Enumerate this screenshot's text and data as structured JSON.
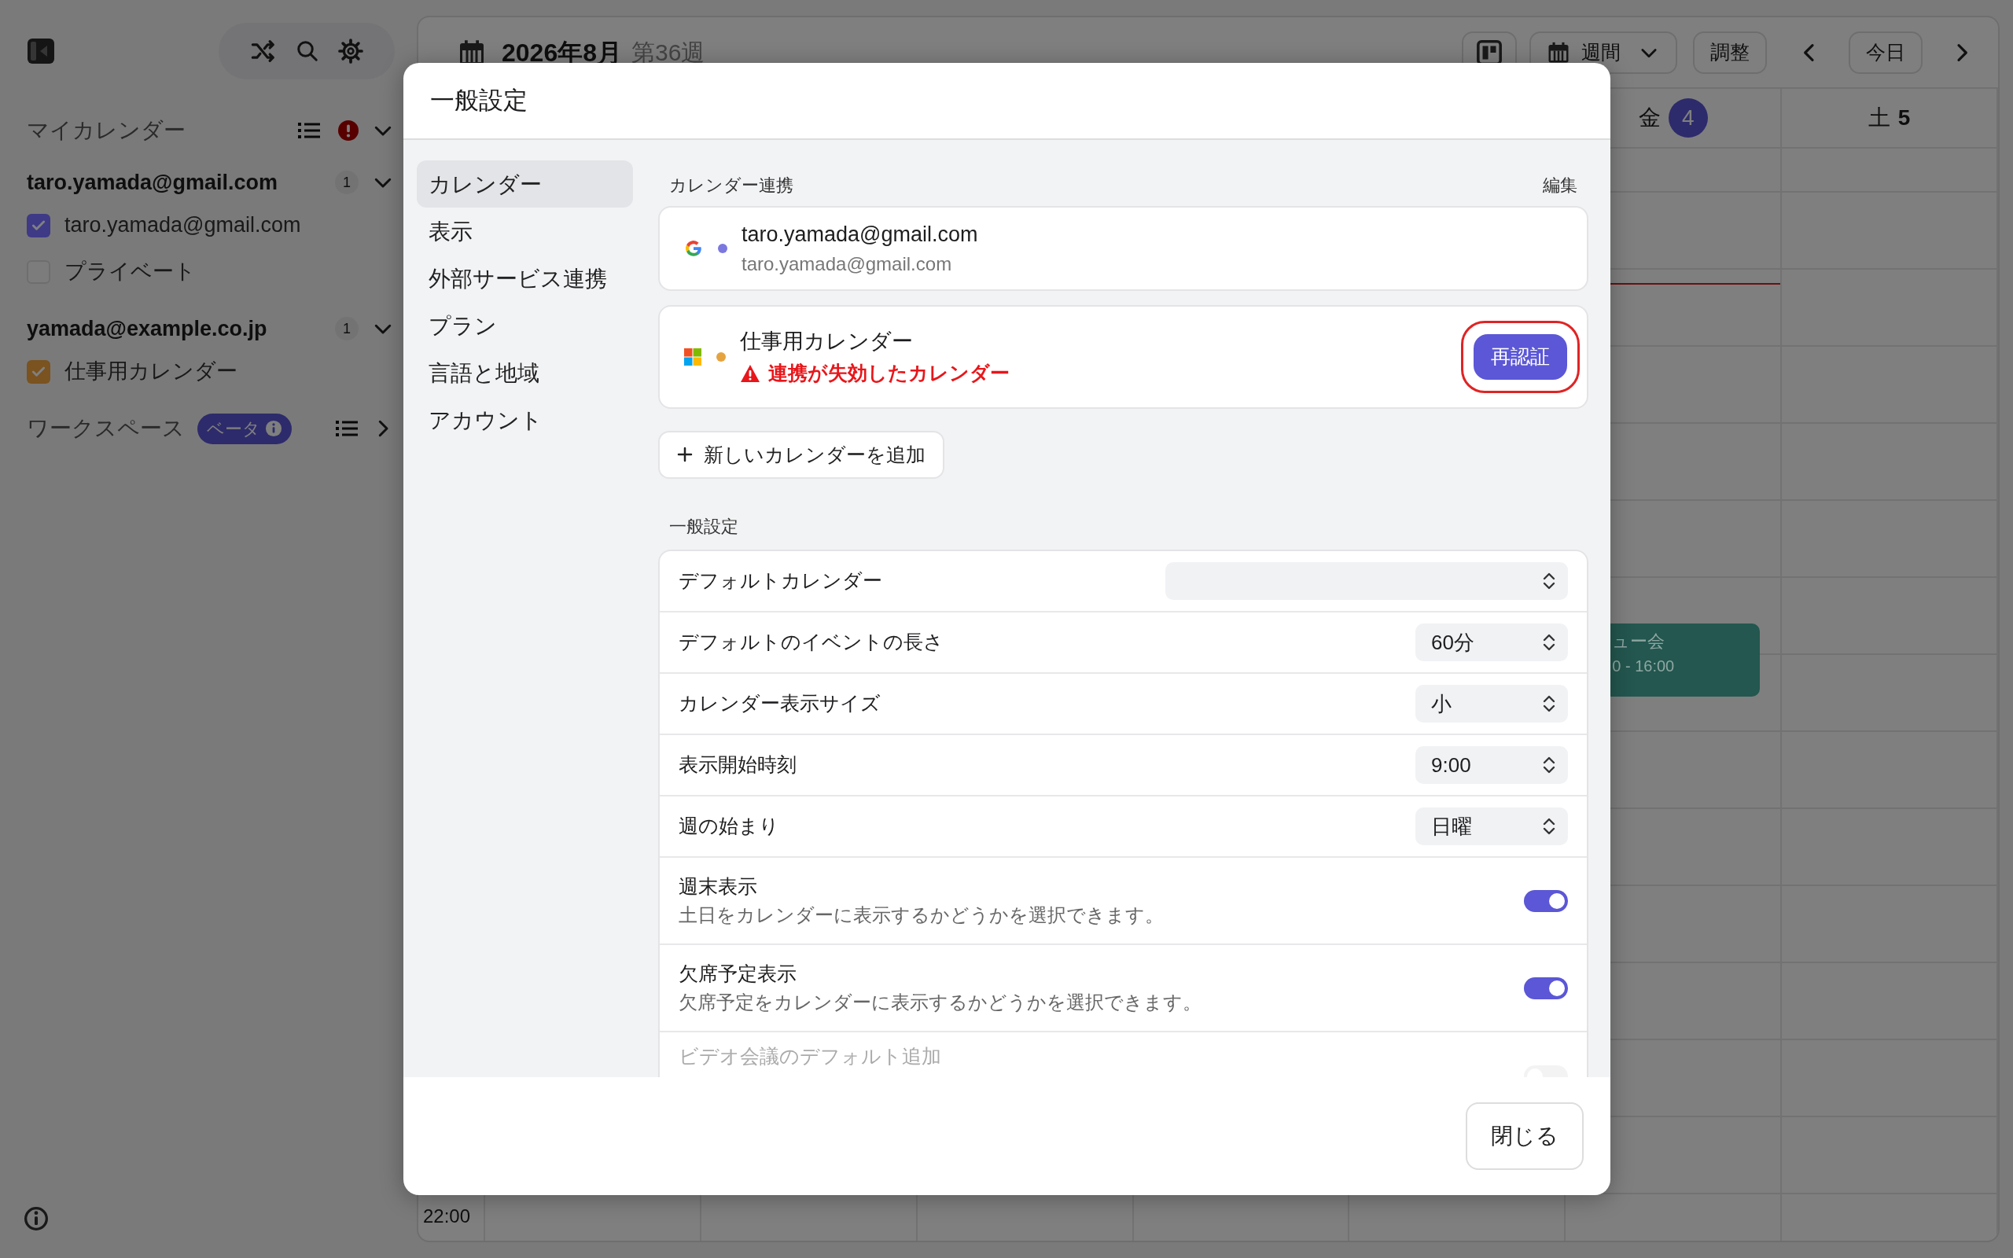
{
  "sidebar": {
    "my_calendars": {
      "title": "マイカレンダー",
      "error": true,
      "expanded": true
    },
    "accounts": [
      {
        "email": "taro.yamada@gmail.com",
        "count": "1",
        "expanded": true,
        "calendars": [
          {
            "name": "taro.yamada@gmail.com",
            "checked": true,
            "color": "#3e3a86"
          },
          {
            "name": "プライベート",
            "checked": false
          }
        ]
      },
      {
        "email": "yamada@example.co.jp",
        "count": "1",
        "expanded": true,
        "calendars": [
          {
            "name": "仕事用カレンダー",
            "checked": true,
            "color": "#7a5320"
          }
        ]
      }
    ],
    "workspace": {
      "title": "ワークスペース",
      "badge": "ベータ",
      "expanded": false
    }
  },
  "header": {
    "month": "2026年8月",
    "week": "第36週",
    "view": "週間",
    "adjust": "調整",
    "today": "今日"
  },
  "calendar": {
    "days": [
      {
        "weekday": "金",
        "date": "4",
        "today": true
      },
      {
        "weekday": "土",
        "date": "5",
        "today": false
      }
    ],
    "event": {
      "title": "ュー会",
      "time": "0 - 16:00",
      "color": "#23574f"
    },
    "time_label": "22:00"
  },
  "modal": {
    "title": "一般設定",
    "nav": [
      {
        "label": "カレンダー",
        "selected": true
      },
      {
        "label": "表示",
        "selected": false
      },
      {
        "label": "外部サービス連携",
        "selected": false
      },
      {
        "label": "プラン",
        "selected": false
      },
      {
        "label": "言語と地域",
        "selected": false
      },
      {
        "label": "アカウント",
        "selected": false
      }
    ],
    "integrations": {
      "heading": "カレンダー連携",
      "edit": "編集",
      "accounts": [
        {
          "kind": "google",
          "name": "taro.yamada@gmail.com",
          "detail": "taro.yamada@gmail.com",
          "color": "#7b78e0"
        },
        {
          "kind": "microsoft",
          "name": "仕事用カレンダー",
          "error": "連携が失効したカレンダー",
          "action": "再認証",
          "highlighted": true,
          "color": "#e5a340"
        }
      ],
      "add": "新しいカレンダーを追加"
    },
    "general": {
      "heading": "一般設定",
      "rows": [
        {
          "kind": "select",
          "label": "デフォルトカレンダー"
        },
        {
          "kind": "select",
          "label": "デフォルトのイベントの長さ",
          "value": "60分"
        },
        {
          "kind": "select",
          "label": "カレンダー表示サイズ",
          "value": "小"
        },
        {
          "kind": "select",
          "label": "表示開始時刻",
          "value": "9:00"
        },
        {
          "kind": "select",
          "label": "週の始まり",
          "value": "日曜"
        },
        {
          "kind": "toggle",
          "label": "週末表示",
          "description": "土日をカレンダーに表示するかどうかを選択できます。",
          "on": true
        },
        {
          "kind": "toggle",
          "label": "欠席予定表示",
          "description": "欠席予定をカレンダーに表示するかどうかを選択できます。",
          "on": true
        },
        {
          "kind": "toggle",
          "label": "ビデオ会議のデフォルト追加",
          "on": false,
          "disabled": true
        }
      ]
    },
    "close": "閉じる"
  }
}
